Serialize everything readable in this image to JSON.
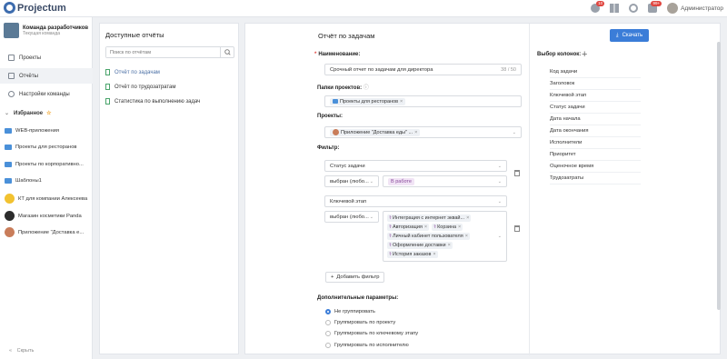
{
  "app": {
    "logo_text": "Projectum"
  },
  "topbar": {
    "notif_badge": "10",
    "chat_badge": "99+",
    "user_name": "Администратор"
  },
  "sidebar": {
    "team_name": "Команда разработчиков",
    "team_sub": "Текущая команда",
    "nav": [
      {
        "label": "Проекты"
      },
      {
        "label": "Отчёты"
      },
      {
        "label": "Настройки команды"
      }
    ],
    "favorites_title": "Избранное",
    "favorites": [
      {
        "label": "WEB-приложения"
      },
      {
        "label": "Проекты для ресторанов"
      },
      {
        "label": "Проекты по корпоративно..."
      },
      {
        "label": "Шаблоны1"
      },
      {
        "label": "КТ для компании Алексеева"
      },
      {
        "label": "Магазин косметики Panda"
      },
      {
        "label": "Приложение \"Доставка е..."
      }
    ],
    "collapse_label": "Скрыть"
  },
  "reports": {
    "title": "Доступные отчёты",
    "search_placeholder": "Поиск по отчётам",
    "items": [
      {
        "label": "Отчёт по задачам"
      },
      {
        "label": "Отчёт по трудозатратам"
      },
      {
        "label": "Статистика по выполнению задач"
      }
    ]
  },
  "main": {
    "title": "Отчёт по задачам",
    "download_label": "Скачать",
    "name_label": "Наименование:",
    "name_value": "Срочный отчет по задачам для директора",
    "name_counter": "38 / 50",
    "folders_label": "Папки проектов:",
    "folder_tag": "Проекты для ресторанов",
    "projects_label": "Проекты:",
    "project_tag": "Приложение \"Доставка еды\" ...",
    "filter_label": "Фильтр:",
    "filter1_field": "Статус задачи",
    "filter1_op": "выбран (любо...",
    "filter1_value": "В работе",
    "filter2_field": "Ключевой этап",
    "filter2_op": "выбран (любо...",
    "filter2_values": [
      "Интеграция с интернет эквай...",
      "Авторизация",
      "Корзина",
      "Личный кабинет пользователя",
      "Оформление доставки",
      "История заказов"
    ],
    "add_filter_label": "Добавить фильтр",
    "extra_label": "Дополнительные параметры:",
    "grouping": [
      {
        "label": "Не группировать",
        "selected": true
      },
      {
        "label": "Группировать по проекту",
        "selected": false
      },
      {
        "label": "Группировать по ключевому этапу",
        "selected": false
      },
      {
        "label": "Группировать по исполнителю",
        "selected": false
      }
    ]
  },
  "columns": {
    "title": "Выбор колонок:",
    "items": [
      "Код задачи",
      "Заголовок",
      "Ключевой этап",
      "Статус задачи",
      "Дата начала",
      "Дата окончания",
      "Исполнители",
      "Приоритет",
      "Оценочное время",
      "Трудозатраты"
    ]
  },
  "colors": {
    "accent": "#3b7dd8",
    "badge": "#e0453f",
    "doc_icon": "#4aa46b"
  }
}
